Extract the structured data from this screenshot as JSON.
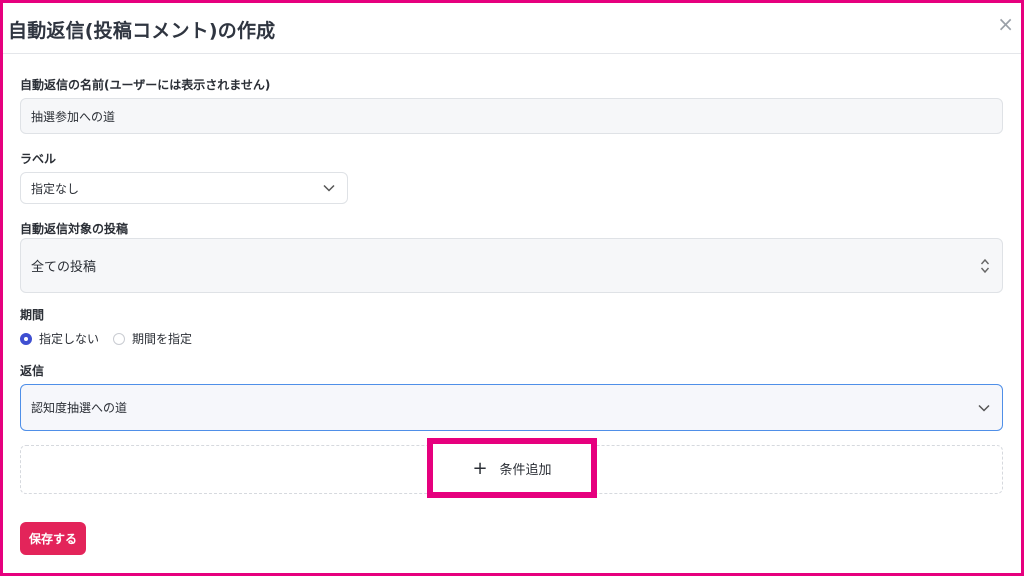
{
  "modal": {
    "title": "自動返信(投稿コメント)の作成",
    "close_label": "×"
  },
  "form": {
    "name": {
      "label": "自動返信の名前(ユーザーには表示されません)",
      "value": "抽選参加への道"
    },
    "label_field": {
      "label": "ラベル",
      "selected": "指定なし"
    },
    "target_post": {
      "label": "自動返信対象の投稿",
      "selected": "全ての投稿"
    },
    "period": {
      "label": "期間",
      "options": [
        "指定しない",
        "期間を指定"
      ],
      "selected_index": 0
    },
    "reply": {
      "label": "返信",
      "selected": "認知度抽選への道"
    },
    "add_condition_label": "条件追加",
    "save_label": "保存する"
  },
  "colors": {
    "accent_pink": "#e6007e",
    "save_button": "#e3245a",
    "radio_selected": "#3f4fd1",
    "focus_border": "#4f8fe8"
  },
  "icons": [
    "close-icon",
    "chevron-down-icon",
    "up-down-chevron-icon",
    "plus-icon"
  ]
}
